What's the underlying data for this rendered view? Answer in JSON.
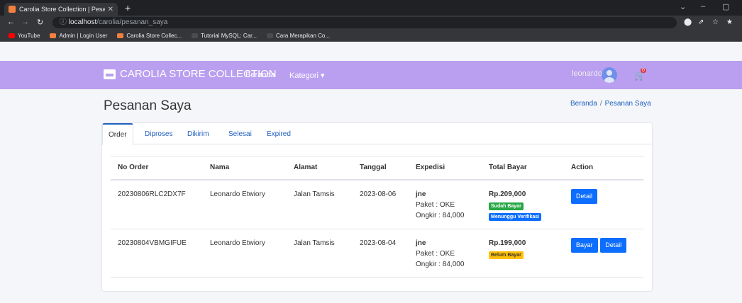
{
  "browser": {
    "tab_title": "Carolia Store Collection | Pesanan",
    "new_tab": "+",
    "url_host": "localhost",
    "url_path": "/carolia/pesanan_saya"
  },
  "bookmarks": [
    {
      "label": "YouTube",
      "color": "#ff0000"
    },
    {
      "label": "Admin | Login User",
      "color": "#f0803c"
    },
    {
      "label": "Carolia Store Collec...",
      "color": "#f0803c"
    },
    {
      "label": "Tutorial MySQL: Car...",
      "color": "#4a4b4f"
    },
    {
      "label": "Cara Merapikan Co...",
      "color": "#4a4b4f"
    }
  ],
  "navbar": {
    "brand": "CAROLIA STORE COLLECTION",
    "home": "Beranda",
    "category": "Kategori ▾",
    "username": "leonardo",
    "cart_count": "0",
    "color": "#ba9ff0"
  },
  "page": {
    "title": "Pesanan Saya",
    "breadcrumb_home": "Beranda",
    "breadcrumb_current": "Pesanan Saya"
  },
  "tabs": [
    "Order",
    "Diproses",
    "Dikirim",
    "Selesai",
    "Expired"
  ],
  "table": {
    "headers": [
      "No Order",
      "Nama",
      "Alamat",
      "Tanggal",
      "Expedisi",
      "Total Bayar",
      "Action"
    ],
    "rows": [
      {
        "no_order": "20230806RLC2DX7F",
        "nama": "Leonardo Etwiory",
        "alamat": "Jalan Tamsis",
        "tanggal": "2023-08-06",
        "kurir": "jne",
        "paket": "Paket : OKE",
        "ongkir": "Ongkir : 84,000",
        "total": "Rp.209,000",
        "status1": "Sudah Bayar",
        "status2": "Menunggu Verifikasi",
        "btn_detail": "Detail"
      },
      {
        "no_order": "20230804VBMGIFUE",
        "nama": "Leonardo Etwiory",
        "alamat": "Jalan Tamsis",
        "tanggal": "2023-08-04",
        "kurir": "jne",
        "paket": "Paket : OKE",
        "ongkir": "Ongkir : 84,000",
        "total": "Rp.199,000",
        "status1": "Belum Bayar",
        "btn_bayar": "Bayar",
        "btn_detail": "Detail"
      }
    ]
  },
  "colors": {
    "success": "#28a745",
    "info": "#0d6efd",
    "warning": "#ffc107",
    "primary": "#0d6efd"
  }
}
